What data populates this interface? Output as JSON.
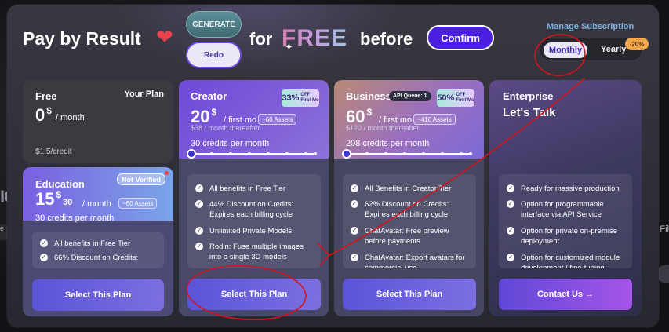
{
  "background": {
    "left_text": "IC",
    "left_pill": "e",
    "right_text": "Fil"
  },
  "header": {
    "title": "Pay by Result",
    "generate_label": "GENERATE",
    "redo_label": "Redo",
    "for_text": "for",
    "free_text": "FREE",
    "before_text": "before",
    "confirm_label": "Confirm",
    "manage_link": "Manage Subscription",
    "billing_toggle": {
      "monthly": "Monthly",
      "yearly": "Yearly",
      "yearly_badge": "-20%",
      "selected": "Monthly"
    }
  },
  "plans": {
    "free": {
      "name": "Free",
      "price": "0",
      "currency": "$",
      "period": "/ month",
      "note": "$1.5/credit",
      "your_plan": "Your Plan"
    },
    "education": {
      "name": "Education",
      "price": "15",
      "currency": "$",
      "old_price": "30",
      "period": "/ month",
      "assets_badge": "~60 Assets",
      "credits": "30 credits per month",
      "status_badge": "Not Verified",
      "features": [
        "All benefits in Free Tier",
        "66% Discount on Credits:"
      ],
      "button": "Select This Plan"
    },
    "creator": {
      "name": "Creator",
      "price": "20",
      "currency": "$",
      "period": "/ first mo.",
      "thereafter": "$38 / month thereafter",
      "assets_badge": "~60 Assets",
      "off_pct": "33%",
      "off_label_1": "OFF",
      "off_label_2": "First Mo",
      "credits": "30 credits per month",
      "slider_position": 0,
      "slider_steps": 8,
      "features": [
        "All benefits in Free Tier",
        "44% Discount on Credits: Expires each billing cycle",
        "Unlimited Private Models",
        "Rodin: Fuse multiple images into a single 3D models"
      ],
      "button": "Select This Plan"
    },
    "business": {
      "name": "Business",
      "api_badge": "API Queue: 1",
      "price": "60",
      "currency": "$",
      "period": "/ first mo.",
      "thereafter": "$120 / month thereafter",
      "assets_badge": "~416 Assets",
      "off_pct": "50%",
      "off_label_1": "OFF",
      "off_label_2": "First Mo",
      "credits": "208 credits per month",
      "slider_position": 0,
      "slider_steps": 8,
      "features": [
        "All Benefits in Creator Tier",
        "62% Discount on Credits: Expires each billing cycle",
        "ChatAvatar: Free preview before payments",
        "ChatAvatar: Export avatars for commercial use"
      ],
      "button": "Select This Plan"
    },
    "enterprise": {
      "name": "Enterprise",
      "headline": "Let's Talk",
      "features": [
        "Ready for massive production",
        "Option for programmable interface via API Service",
        "Option for private on-premise deployment",
        "Option for customized module development / fine-tuning"
      ],
      "button": "Contact Us →"
    }
  },
  "colors": {
    "accent": "#4a1fe0",
    "heart": "#e8424f",
    "link": "#7db4e6",
    "annotation": "#d4141c"
  }
}
